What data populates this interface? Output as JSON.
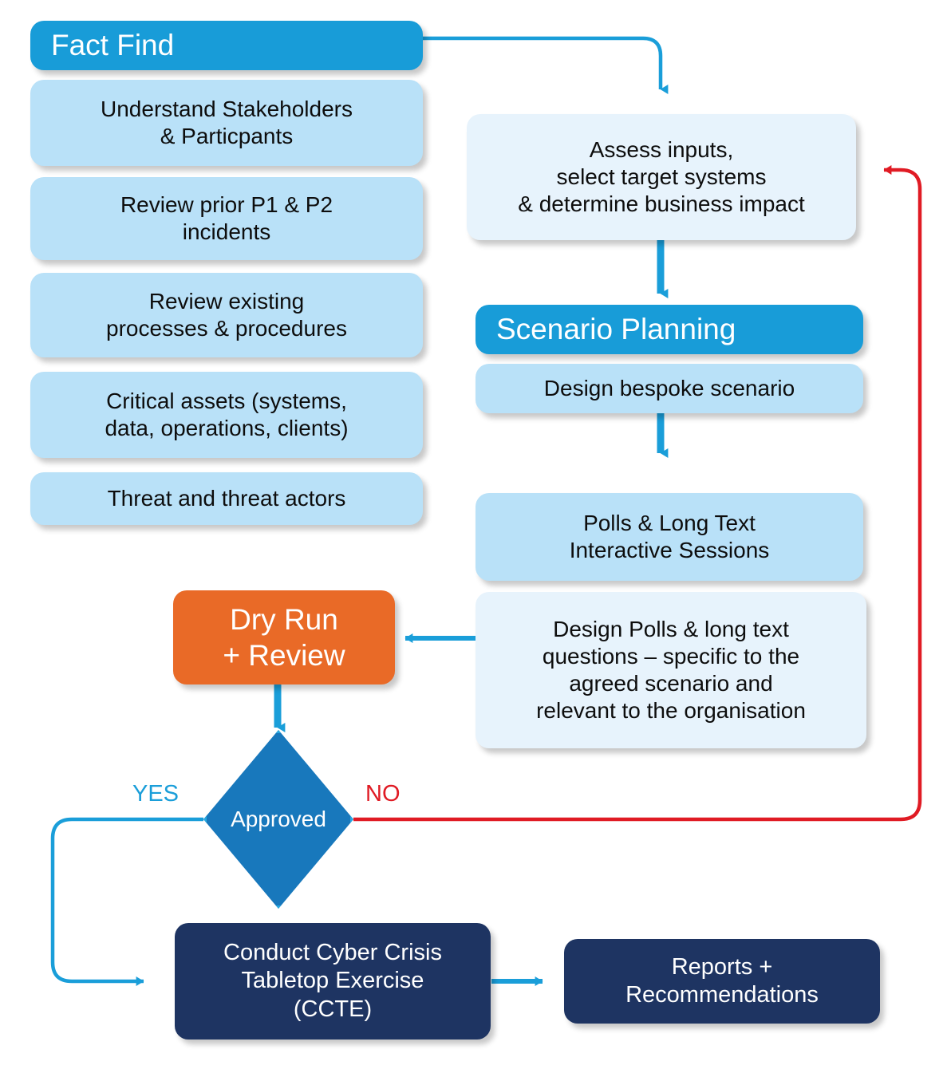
{
  "diagram": {
    "title": "Cyber Crisis Tabletop Exercise Process Flow",
    "colors": {
      "header_blue": "#189cd8",
      "task_light_blue": "#b9e1f8",
      "pale_blue": "#e7f3fc",
      "orange": "#e96a27",
      "navy": "#1e3462",
      "diamond_fill": "#1878bc",
      "diamond_stroke": "#29a8e0",
      "connector_blue": "#1a9ed9",
      "connector_red": "#e01b24"
    }
  },
  "fact_find": {
    "header": "Fact Find",
    "items": [
      "Understand Stakeholders\n& Particpants",
      "Review prior P1 & P2\nincidents",
      "Review existing\nprocesses & procedures",
      "Critical assets (systems,\ndata, operations, clients)",
      "Threat and threat actors"
    ]
  },
  "assess": {
    "text": "Assess inputs,\nselect target systems\n& determine business impact"
  },
  "scenario_planning": {
    "header": "Scenario Planning",
    "design_scenario": "Design bespoke scenario",
    "polls_sessions": "Polls & Long Text\nInteractive Sessions",
    "design_polls": "Design Polls & long text\nquestions – specific to the\nagreed scenario and\nrelevant to the organisation"
  },
  "dry_run": {
    "label": "Dry Run\n+ Review"
  },
  "decision": {
    "label": "Approved",
    "yes_label": "YES",
    "no_label": "NO"
  },
  "outcomes": {
    "exercise": "Conduct Cyber Crisis\nTabletop Exercise\n(CCTE)",
    "reports": "Reports +\nRecommendations"
  }
}
